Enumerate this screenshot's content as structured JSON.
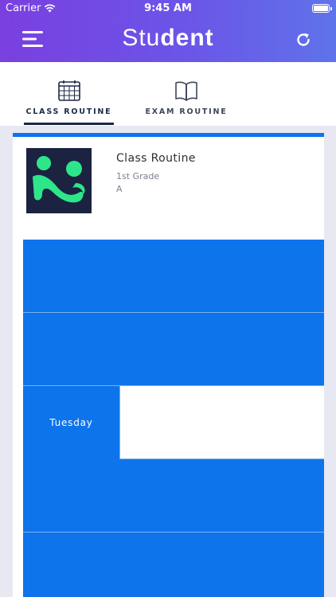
{
  "status_bar": {
    "carrier": "Carrier",
    "time": "9:45 AM"
  },
  "app_bar": {
    "title_light": "Stu",
    "title_bold": "dent"
  },
  "tabs": [
    {
      "label": "CLASS ROUTINE",
      "icon": "calendar-grid-icon",
      "active": true
    },
    {
      "label": "EXAM ROUTINE",
      "icon": "open-book-icon",
      "active": false
    }
  ],
  "card": {
    "title": "Class Routine",
    "grade": "1st Grade",
    "section": "A"
  },
  "routine": {
    "rows": [
      {
        "day": ""
      },
      {
        "day": ""
      },
      {
        "day": "Tuesday"
      },
      {
        "day": ""
      },
      {
        "day": ""
      }
    ]
  },
  "colors": {
    "header_start": "#7a3fe0",
    "header_end": "#5f73ea",
    "accent": "#0d74ec",
    "logo_green": "#2ee68a",
    "logo_bg": "#1b2340"
  }
}
